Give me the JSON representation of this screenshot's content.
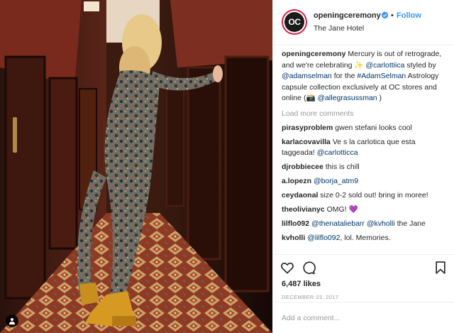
{
  "header": {
    "username": "openingceremony",
    "avatar_text": "OC",
    "follow_label": "Follow",
    "separator": "•",
    "location": "The Jane Hotel"
  },
  "caption": {
    "username": "openingceremony",
    "text_1": "Mercury is out of retrograde, and we're celebrating ✨",
    "mention_1": "@carlottiica",
    "text_2": " styled by ",
    "mention_2": "@adamselman",
    "text_3": " for the ",
    "hashtag": "#AdamSelman",
    "text_4": " Astrology capsule collection exclusively at OC stores and online (📸 ",
    "mention_3": "@allegrasussman",
    "text_5": " )"
  },
  "load_more_label": "Load more comments",
  "comments": [
    {
      "user": "pirasyproblem",
      "pre": "gwen stefani looks cool",
      "mention": "",
      "post": ""
    },
    {
      "user": "karlacovavilla",
      "pre": "Ve s la carlotica que esta taggeada! ",
      "mention": "@carlotticca",
      "post": ""
    },
    {
      "user": "djrobbiecee",
      "pre": "this is chill",
      "mention": "",
      "post": ""
    },
    {
      "user": "a.lopezn",
      "pre": "",
      "mention": "@borja_atm9",
      "post": ""
    },
    {
      "user": "ceydaonal",
      "pre": "size 0-2 sold out! bring in moree!",
      "mention": "",
      "post": ""
    },
    {
      "user": "theolivianyc",
      "pre": "OMG! 💜",
      "mention": "",
      "post": ""
    },
    {
      "user": "lilflo092",
      "pre": "",
      "mention": "@thenataliebarr @kvholli",
      "post": " the Jane"
    },
    {
      "user": "kvholli",
      "pre": "",
      "mention": "@lilflo092",
      "post": ", lol. Memories."
    }
  ],
  "actions": {
    "likes": "6,487 likes",
    "date": "DECEMBER 23, 2017",
    "icons": [
      "heart-icon",
      "comment-icon",
      "bookmark-icon"
    ]
  },
  "add_comment": {
    "placeholder": "Add a comment..."
  },
  "colors": {
    "link": "#003569",
    "follow": "#3897f0",
    "verified": "#3897f0",
    "muted": "#999999",
    "avatar_ring": "#d91e46"
  }
}
